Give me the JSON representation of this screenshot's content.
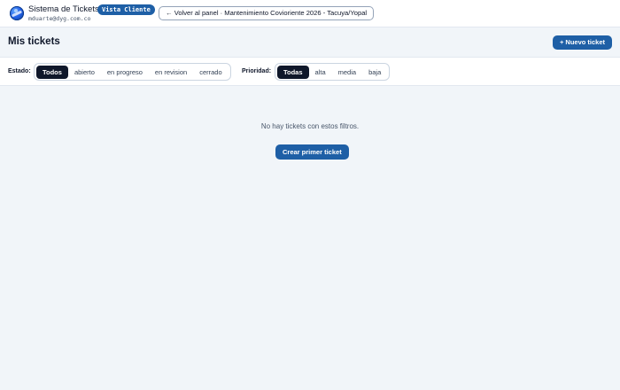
{
  "header": {
    "app_title": "Sistema de Tickets",
    "role_badge": "Vista Cliente",
    "user_email": "mduarte@dyg.com.co",
    "back_button": "← Volver al panel · Mantenimiento Covioriente 2026 - Tacuya/Yopal"
  },
  "page": {
    "title": "Mis tickets",
    "new_ticket_button": "+ Nuevo ticket"
  },
  "filters": {
    "status": {
      "label": "Estado:",
      "options": [
        "Todos",
        "abierto",
        "en progreso",
        "en revision",
        "cerrado"
      ],
      "selected": "Todos"
    },
    "priority": {
      "label": "Prioridad:",
      "options": [
        "Todas",
        "alta",
        "media",
        "baja"
      ],
      "selected": "Todas"
    }
  },
  "empty_state": {
    "message": "No hay tickets con estos filtros.",
    "create_button": "Crear primer ticket"
  },
  "colors": {
    "accent": "#1e5fa6",
    "active_pill": "#0f172a",
    "background": "#f1f5f9"
  }
}
